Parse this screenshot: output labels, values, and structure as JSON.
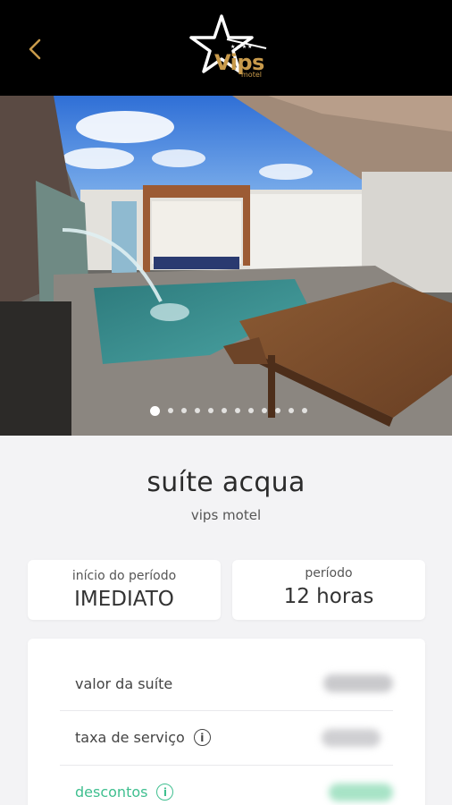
{
  "header": {
    "back_icon": "chevron-left-icon",
    "logo": {
      "stars": "★★★★",
      "text": "Vips",
      "sub": "motel",
      "icon": "star-logo-icon"
    }
  },
  "gallery": {
    "total": 12,
    "active": 1
  },
  "suite": {
    "name": "suíte acqua",
    "motel": "vips motel"
  },
  "period": {
    "start_label": "início do período",
    "start_value": "IMEDIATO",
    "duration_label": "período",
    "duration_value": "12 horas"
  },
  "prices": {
    "rows": [
      {
        "label": "valor da suíte"
      },
      {
        "label": "taxa de serviço"
      },
      {
        "label": "descontos"
      }
    ]
  },
  "colors": {
    "accent_gold": "#c89a4b",
    "discount_green": "#3fbf8f"
  }
}
